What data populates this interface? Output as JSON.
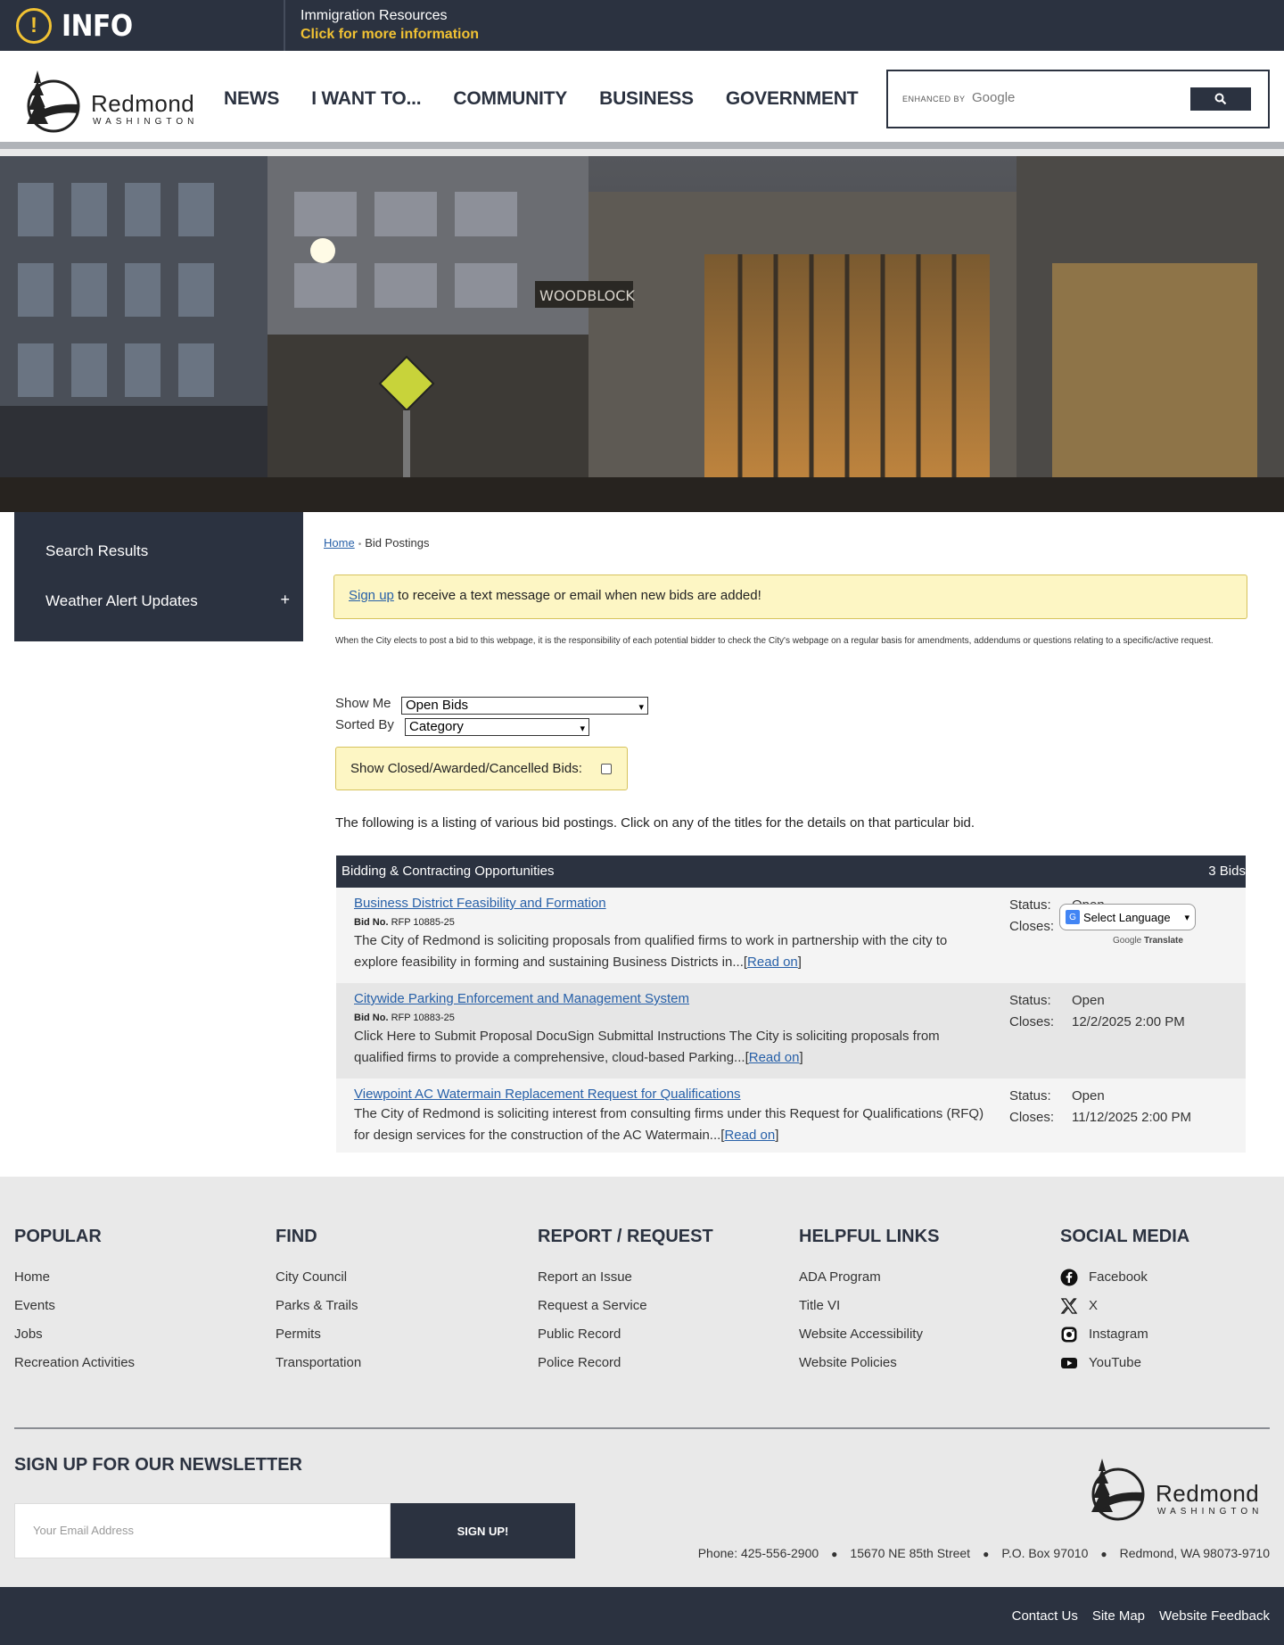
{
  "alert": {
    "title": "INFO",
    "icon": "exclamation-icon",
    "line1": "Immigration Resources",
    "line2": "Click for more information"
  },
  "header": {
    "logo_word": "Redmond",
    "logo_sub": "WASHINGTON",
    "nav": [
      "NEWS",
      "I WANT TO...",
      "COMMUNITY",
      "BUSINESS",
      "GOVERNMENT"
    ],
    "search_enhanced": "ENHANCED BY",
    "search_google": "Google"
  },
  "sidebar": {
    "items": [
      {
        "label": "Search Results"
      },
      {
        "label": "Weather Alert Updates",
        "expand": "+"
      }
    ]
  },
  "breadcrumb": {
    "home": "Home",
    "current": "Bid Postings"
  },
  "notice": {
    "link": "Sign up",
    "text": " to receive a text message or email when new bids are added!"
  },
  "disclaimer": "When the City elects to post a bid to this webpage, it is the responsibility of each potential bidder to check the City's webpage on a regular basis for amendments, addendums or questions relating to a specific/active request.",
  "filters": {
    "show_me_label": "Show Me",
    "show_me_value": "Open Bids",
    "sorted_by_label": "Sorted By",
    "sorted_by_value": "Category",
    "closed_label": "Show Closed/Awarded/Cancelled Bids:"
  },
  "listing_text": "The following is a listing of various bid postings. Click on any of the titles for the details on that particular bid.",
  "table": {
    "header": "Bidding & Contracting Opportunities",
    "count": "3 Bids",
    "status_label": "Status:",
    "closes_label": "Closes:",
    "bid_no_label": "Bid No.",
    "read_on": "Read on",
    "rows": [
      {
        "title": "Business District Feasibility and Formation",
        "bid_no": "RFP 10885-25",
        "desc": "The City of Redmond is soliciting proposals from qualified firms to work in partnership with the city to explore feasibility in forming and sustaining Business Districts in...",
        "status": "Open",
        "closes": ""
      },
      {
        "title": "Citywide Parking Enforcement and Management System",
        "bid_no": "RFP 10883-25",
        "desc": "Click Here to Submit Proposal DocuSign Submittal Instructions The City is soliciting proposals from qualified firms to provide a comprehensive, cloud-based Parking...",
        "status": "Open",
        "closes": "12/2/2025 2:00 PM"
      },
      {
        "title": "Viewpoint AC Watermain Replacement Request for Qualifications",
        "bid_no": "",
        "desc": "The City of Redmond is soliciting interest from consulting firms under this Request for Qualifications (RFQ) for design services for the construction of the AC Watermain...",
        "status": "Open",
        "closes": "11/12/2025 2:00 PM"
      }
    ]
  },
  "translate": {
    "label": "Select Language",
    "powered_by": "Google",
    "translate_word": "Translate"
  },
  "footer": {
    "columns": [
      {
        "title": "POPULAR",
        "links": [
          "Home",
          "Events",
          "Jobs",
          "Recreation Activities"
        ]
      },
      {
        "title": "FIND",
        "links": [
          "City Council",
          "Parks & Trails",
          "Permits",
          "Transportation"
        ]
      },
      {
        "title": "REPORT / REQUEST",
        "links": [
          "Report an Issue",
          "Request a Service",
          "Public Record",
          "Police Record"
        ]
      },
      {
        "title": "HELPFUL LINKS",
        "links": [
          "ADA Program",
          "Title VI",
          "Website Accessibility",
          "Website Policies"
        ]
      },
      {
        "title": "SOCIAL MEDIA",
        "links": [
          "Facebook",
          "X",
          "Instagram",
          "YouTube"
        ]
      }
    ],
    "newsletter_title": "SIGN UP FOR OUR NEWSLETTER",
    "newsletter_placeholder": "Your Email Address",
    "newsletter_button": "SIGN UP!",
    "logo_word": "Redmond",
    "logo_sub": "WASHINGTON",
    "contact": [
      "Phone: 425-556-2900",
      "15670 NE 85th Street",
      "P.O. Box 97010",
      "Redmond, WA 98073-9710"
    ],
    "bottom_links": [
      "Contact Us",
      "Site Map",
      "Website Feedback"
    ]
  },
  "colors": {
    "navy": "#2b3240",
    "accent_yellow": "#f1c233",
    "link_blue": "#2760a8",
    "notice_bg": "#fdf6c4"
  }
}
